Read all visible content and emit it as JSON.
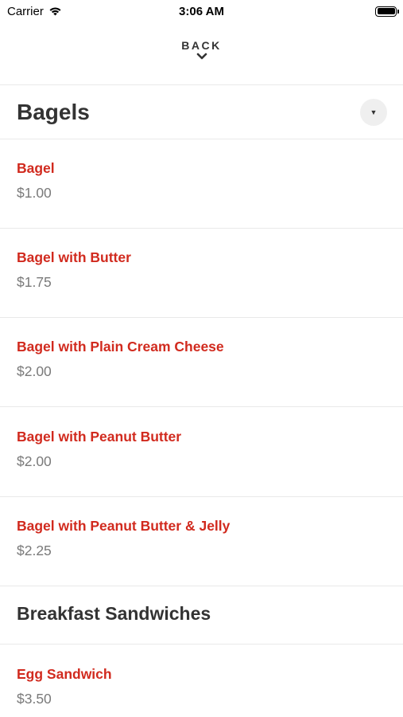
{
  "status_bar": {
    "carrier": "Carrier",
    "time": "3:06 AM",
    "icons": [
      "wifi-icon",
      "battery-icon"
    ]
  },
  "nav": {
    "back_label": "BACK",
    "back_icon": "chevron-down-icon"
  },
  "category": {
    "title": "Bagels",
    "toggle_icon": "caret-down-icon"
  },
  "items": [
    {
      "name": "Bagel",
      "price": "$1.00"
    },
    {
      "name": "Bagel with Butter",
      "price": "$1.75"
    },
    {
      "name": "Bagel with Plain Cream Cheese",
      "price": "$2.00"
    },
    {
      "name": "Bagel with Peanut Butter",
      "price": "$2.00"
    },
    {
      "name": "Bagel with Peanut Butter & Jelly",
      "price": "$2.25"
    }
  ],
  "subcategory": {
    "title": "Breakfast Sandwiches",
    "items": [
      {
        "name": "Egg Sandwich",
        "price": "$3.50"
      }
    ]
  },
  "colors": {
    "item_name": "#d12a1e",
    "price": "#7a7a7a",
    "heading": "#333333",
    "divider": "#e9e9e9"
  }
}
